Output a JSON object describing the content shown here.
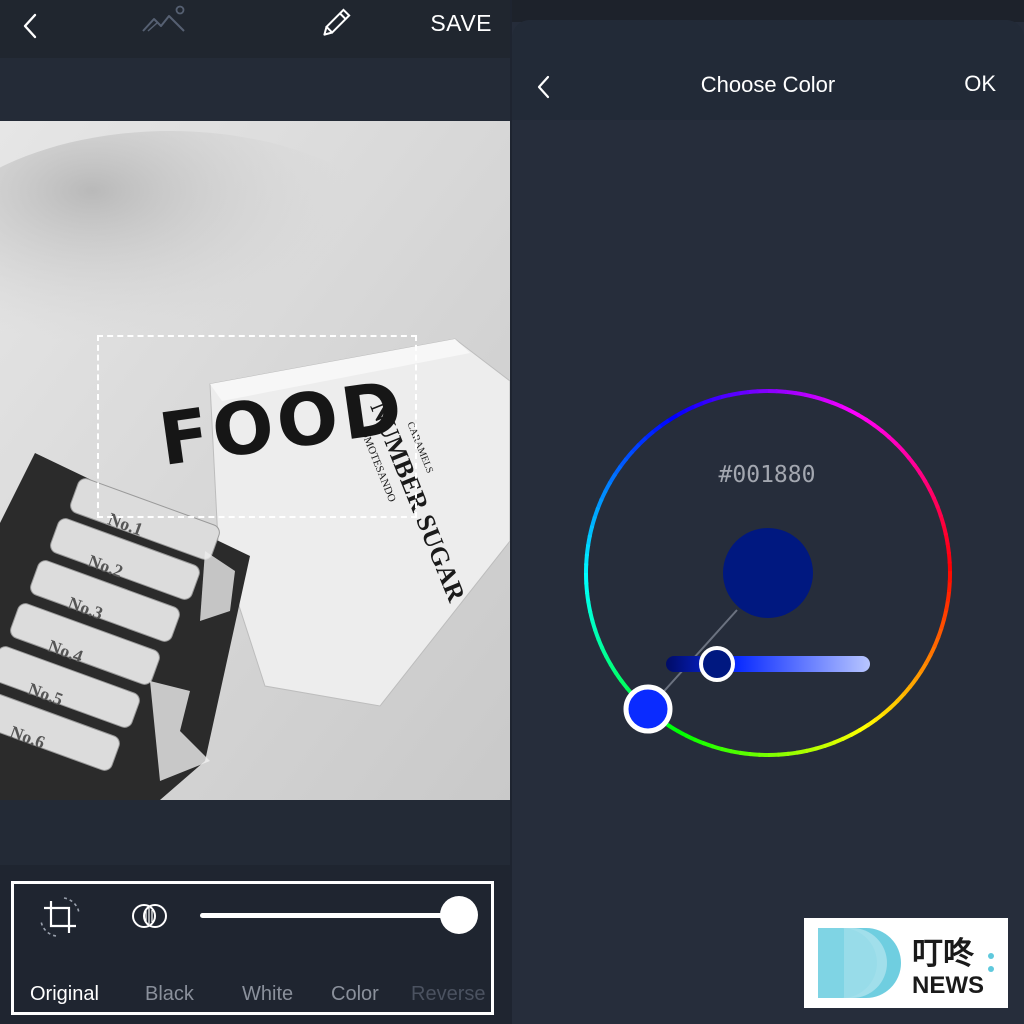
{
  "left": {
    "toolbar": {
      "save_label": "SAVE",
      "icons": [
        "back-icon",
        "image-icon",
        "pen-icon"
      ]
    },
    "photo": {
      "text_sticker": "FOOD"
    },
    "modes": {
      "items": [
        "Original",
        "Black",
        "White",
        "Color",
        "Reverse"
      ],
      "selected": "Original",
      "icons": [
        "crop-icon",
        "overlap-circles-icon"
      ]
    },
    "opacity_slider": {
      "value": 1.0
    }
  },
  "right": {
    "header": {
      "title": "Choose Color",
      "ok_label": "OK",
      "back_icon": "back-icon"
    },
    "picker": {
      "hex": "#001880",
      "selected_color": "#001880",
      "hue_color": "#0a2bff",
      "brightness_slider_value": 0.2
    }
  },
  "watermark": {
    "cn": "叮咚",
    "en": "NEWS",
    "accent": "#5fc9dd"
  }
}
